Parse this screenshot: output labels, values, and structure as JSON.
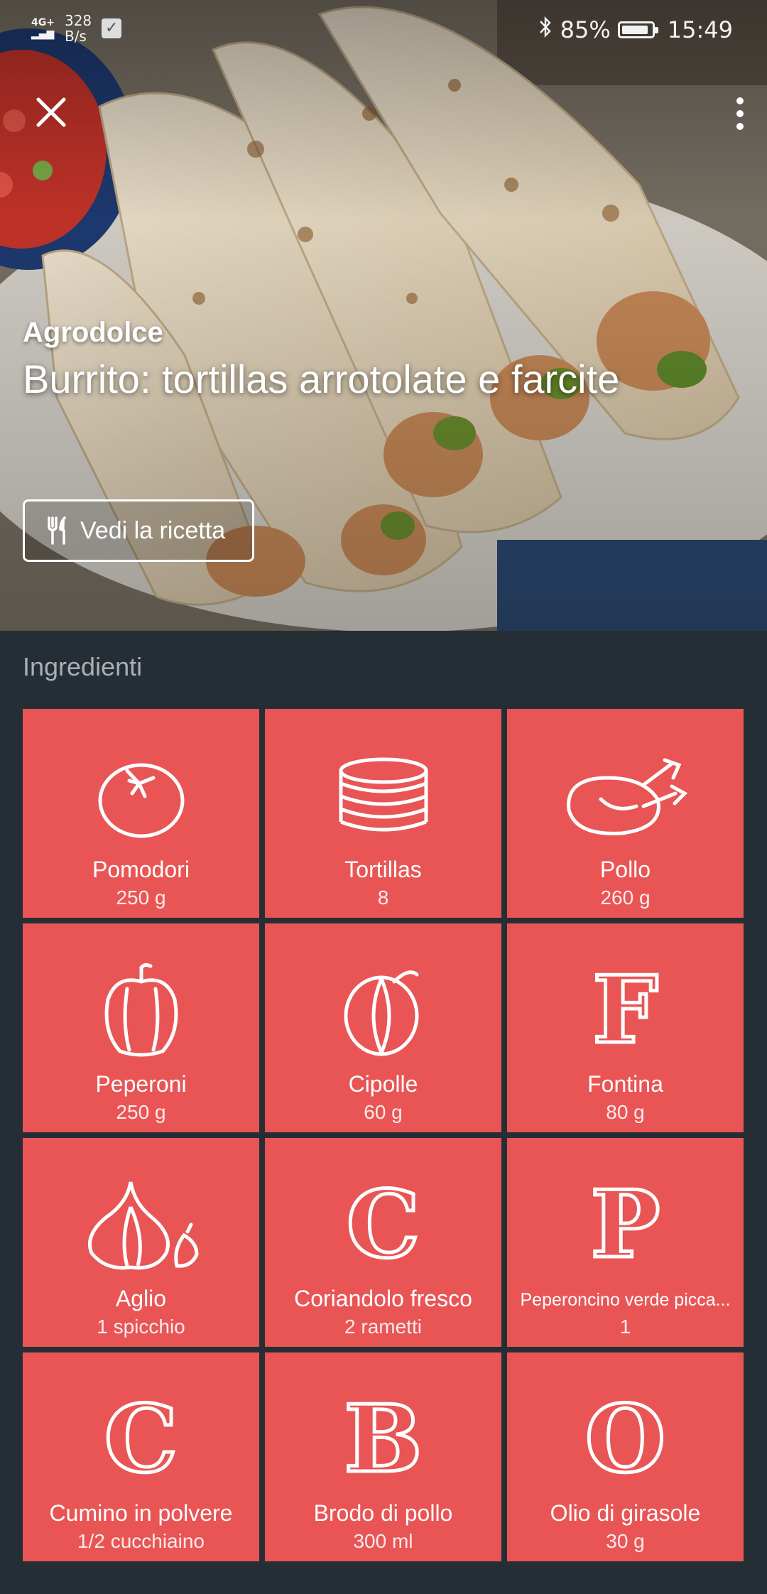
{
  "status_bar": {
    "network": "4G+",
    "net_speed_value": "328",
    "net_speed_unit": "B/s",
    "battery": "85%",
    "time": "15:49"
  },
  "hero": {
    "category": "Agrodolce",
    "title": "Burrito: tortillas arrotolate e farcite",
    "recipe_button": "Vedi la ricetta"
  },
  "ingredients_title": "Ingredienti",
  "ingredients": [
    {
      "name": "Pomodori",
      "qty": "250 g",
      "icon": "tomato-icon"
    },
    {
      "name": "Tortillas",
      "qty": "8",
      "icon": "tortillas-icon"
    },
    {
      "name": "Pollo",
      "qty": "260 g",
      "icon": "chicken-icon"
    },
    {
      "name": "Peperoni",
      "qty": "250 g",
      "icon": "pepper-icon"
    },
    {
      "name": "Cipolle",
      "qty": "60 g",
      "icon": "onion-icon"
    },
    {
      "name": "Fontina",
      "qty": "80 g",
      "icon": "letter-F-icon",
      "letter": "F"
    },
    {
      "name": "Aglio",
      "qty": "1 spicchio",
      "icon": "garlic-icon"
    },
    {
      "name": "Coriandolo fresco",
      "qty": "2 rametti",
      "icon": "letter-C-icon",
      "letter": "C"
    },
    {
      "name": "Peperoncino verde picca...",
      "qty": "1",
      "icon": "letter-P-icon",
      "letter": "P"
    },
    {
      "name": "Cumino in polvere",
      "qty": "1/2 cucchiaino",
      "icon": "letter-C-icon",
      "letter": "C"
    },
    {
      "name": "Brodo di pollo",
      "qty": "300 ml",
      "icon": "letter-B-icon",
      "letter": "B"
    },
    {
      "name": "Olio di girasole",
      "qty": "30 g",
      "icon": "letter-O-icon",
      "letter": "O"
    }
  ],
  "colors": {
    "tile": "#e95555",
    "background": "#262e35",
    "section_title": "#a9b0b5"
  }
}
